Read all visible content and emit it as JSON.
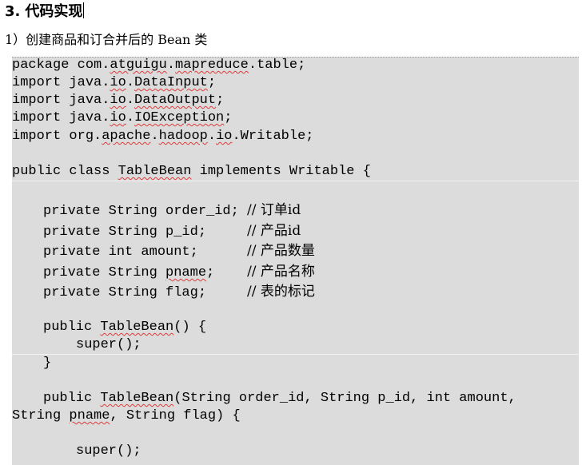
{
  "heading": {
    "number": "3.",
    "text": "代码实现"
  },
  "subheading": "1）创建商品和订合并后的 Bean 类",
  "code": {
    "package_line": [
      "package com.",
      "atguigu",
      ".",
      "mapreduce",
      ".table;"
    ],
    "imports": [
      [
        "import java.",
        "io",
        ".",
        "DataInput",
        ";"
      ],
      [
        "import java.",
        "io",
        ".",
        "DataOutput",
        ";"
      ],
      [
        "import java.",
        "io",
        ".",
        "IOException",
        ";"
      ],
      [
        "import org.",
        "apache",
        ".",
        "hadoop",
        ".",
        "io",
        ".Writable;"
      ]
    ],
    "class_decl": [
      "public class ",
      "TableBean",
      " implements Writable {"
    ],
    "fields": [
      {
        "decl": "private String order_id; ",
        "comment": "// 订单id"
      },
      {
        "decl": "private String p_id;     ",
        "comment": "// 产品id"
      },
      {
        "decl": "private int amount;      ",
        "comment": "// 产品数量"
      },
      {
        "decl_pre": "private String ",
        "decl_squig": "pname",
        "decl_post": ";    ",
        "comment": "// 产品名称"
      },
      {
        "decl": "private String flag;     ",
        "comment": "// 表的标记"
      }
    ],
    "ctor1": [
      "public ",
      "TableBean",
      "() {"
    ],
    "super1": "super();",
    "close1": "}",
    "ctor2_line1": [
      "public ",
      "TableBean",
      "(String order_id, String p_id, int amount,"
    ],
    "ctor2_line2": [
      "String ",
      "pname",
      ", String flag) {"
    ],
    "super2": "super();"
  }
}
